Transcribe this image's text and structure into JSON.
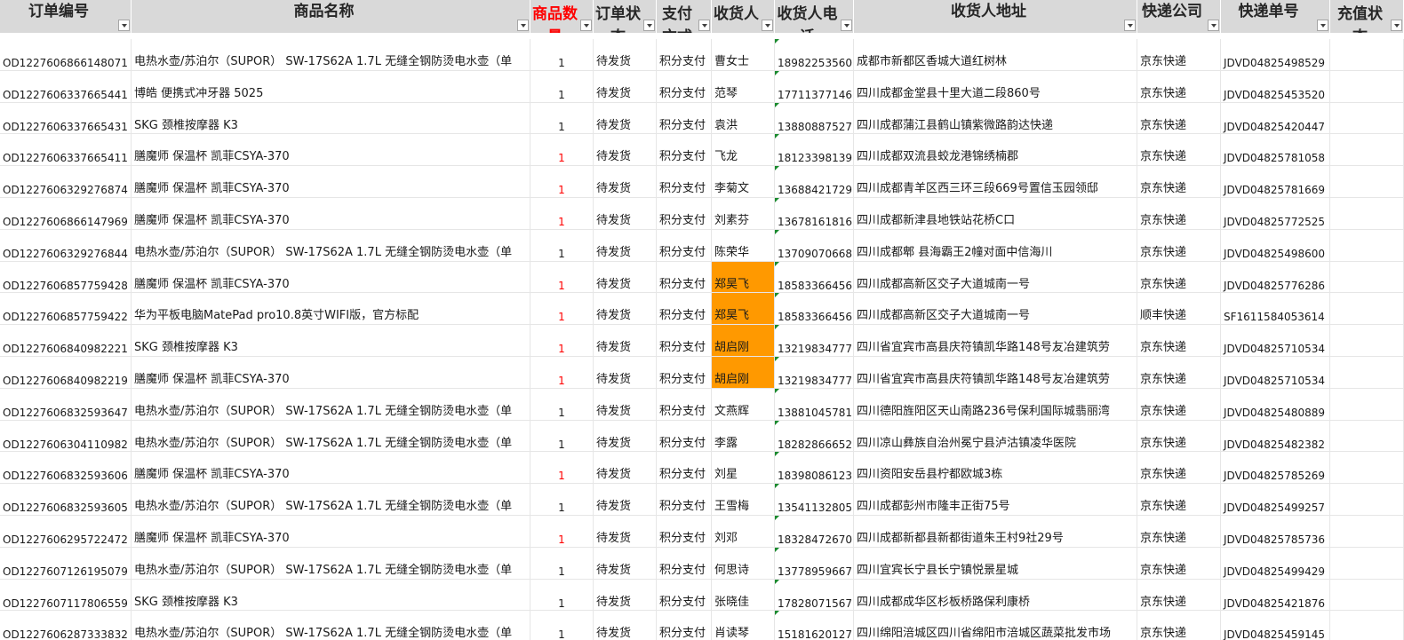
{
  "header": {
    "order_no": "订单编号",
    "product": "商品名称",
    "qty": "商品数量",
    "status": "订单状态",
    "pay": "支付方式",
    "receiver": "收货人",
    "phone": "收货人电话",
    "address": "收货人地址",
    "courier": "快递公司",
    "tracking": "快递单号",
    "recharge": "充值状态"
  },
  "accent": {
    "header_bg": "#d9d9d9",
    "highlight": "#ff9900",
    "red_text": "#ff0000",
    "grid": "#e6e6e6"
  },
  "rows": [
    {
      "order_no": "OD1227606866148071",
      "product": "电热水壶/苏泊尔（SUPOR） SW-17S62A 1.7L 无缝全钢防烫电水壶（单",
      "qty": "1",
      "status": "待发货",
      "pay": "积分支付",
      "receiver": "曹女士",
      "phone": "18982253560",
      "address": "成都市新都区香城大道红树林",
      "courier": "京东快递",
      "tracking": "JDVD04825498529",
      "qty_red": false,
      "hl": false
    },
    {
      "order_no": "OD1227606337665441",
      "product": "博皓 便携式冲牙器 5025",
      "qty": "1",
      "status": "待发货",
      "pay": "积分支付",
      "receiver": "范琴",
      "phone": "17711377146",
      "address": "四川成都金堂县十里大道二段860号",
      "courier": "京东快递",
      "tracking": "JDVD04825453520",
      "qty_red": false,
      "hl": false
    },
    {
      "order_no": "OD1227606337665431",
      "product": "SKG 颈椎按摩器 K3",
      "qty": "1",
      "status": "待发货",
      "pay": "积分支付",
      "receiver": "袁洪",
      "phone": "13880887527",
      "address": "四川成都蒲江县鹤山镇紫微路韵达快递",
      "courier": "京东快递",
      "tracking": "JDVD04825420447",
      "qty_red": false,
      "hl": false
    },
    {
      "order_no": "OD1227606337665411",
      "product": "膳魔师 保温杯 凯菲CSYA-370",
      "qty": "1",
      "status": "待发货",
      "pay": "积分支付",
      "receiver": "飞龙",
      "phone": "18123398139",
      "address": "四川成都双流县蛟龙港锦绣楠郡",
      "courier": "京东快递",
      "tracking": "JDVD04825781058",
      "qty_red": true,
      "hl": false
    },
    {
      "order_no": "OD1227606329276874",
      "product": "膳魔师 保温杯 凯菲CSYA-370",
      "qty": "1",
      "status": "待发货",
      "pay": "积分支付",
      "receiver": "李菊文",
      "phone": "13688421729",
      "address": "四川成都青羊区西三环三段669号置信玉园领邸",
      "courier": "京东快递",
      "tracking": "JDVD04825781669",
      "qty_red": true,
      "hl": false
    },
    {
      "order_no": "OD1227606866147969",
      "product": "膳魔师 保温杯 凯菲CSYA-370",
      "qty": "1",
      "status": "待发货",
      "pay": "积分支付",
      "receiver": "刘素芬",
      "phone": "13678161816",
      "address": "四川成都新津县地铁站花桥C口",
      "courier": "京东快递",
      "tracking": "JDVD04825772525",
      "qty_red": true,
      "hl": false
    },
    {
      "order_no": "OD1227606329276844",
      "product": "电热水壶/苏泊尔（SUPOR） SW-17S62A 1.7L 无缝全钢防烫电水壶（单",
      "qty": "1",
      "status": "待发货",
      "pay": "积分支付",
      "receiver": "陈荣华",
      "phone": "13709070668",
      "address": "四川成都郫 县海霸王2幢对面中信海川",
      "courier": "京东快递",
      "tracking": "JDVD04825498600",
      "qty_red": false,
      "hl": false
    },
    {
      "order_no": "OD1227606857759428",
      "product": "膳魔师 保温杯 凯菲CSYA-370",
      "qty": "1",
      "status": "待发货",
      "pay": "积分支付",
      "receiver": "郑昊飞",
      "phone": "18583366456",
      "address": "四川成都高新区交子大道城南一号",
      "courier": "京东快递",
      "tracking": "JDVD04825776286",
      "qty_red": true,
      "hl": true
    },
    {
      "order_no": "OD1227606857759422",
      "product": "华为平板电脑MatePad pro10.8英寸WIFI版，官方标配",
      "qty": "1",
      "status": "待发货",
      "pay": "积分支付",
      "receiver": "郑昊飞",
      "phone": "18583366456",
      "address": "四川成都高新区交子大道城南一号",
      "courier": "顺丰快递",
      "tracking": "SF1611584053614",
      "qty_red": true,
      "hl": true
    },
    {
      "order_no": "OD1227606840982221",
      "product": "SKG 颈椎按摩器 K3",
      "qty": "1",
      "status": "待发货",
      "pay": "积分支付",
      "receiver": "胡启刚",
      "phone": "13219834777",
      "address": "四川省宜宾市高县庆符镇凯华路148号友冶建筑劳",
      "courier": "京东快递",
      "tracking": "JDVD04825710534",
      "qty_red": true,
      "hl": true
    },
    {
      "order_no": "OD1227606840982219",
      "product": "膳魔师 保温杯 凯菲CSYA-370",
      "qty": "1",
      "status": "待发货",
      "pay": "积分支付",
      "receiver": "胡启刚",
      "phone": "13219834777",
      "address": "四川省宜宾市高县庆符镇凯华路148号友冶建筑劳",
      "courier": "京东快递",
      "tracking": "JDVD04825710534",
      "qty_red": true,
      "hl": true
    },
    {
      "order_no": "OD1227606832593647",
      "product": "电热水壶/苏泊尔（SUPOR） SW-17S62A 1.7L 无缝全钢防烫电水壶（单",
      "qty": "1",
      "status": "待发货",
      "pay": "积分支付",
      "receiver": "文燕辉",
      "phone": "13881045781",
      "address": "四川德阳旌阳区天山南路236号保利国际城翡丽湾",
      "courier": "京东快递",
      "tracking": "JDVD04825480889",
      "qty_red": false,
      "hl": false
    },
    {
      "order_no": "OD1227606304110982",
      "product": "电热水壶/苏泊尔（SUPOR） SW-17S62A 1.7L 无缝全钢防烫电水壶（单",
      "qty": "1",
      "status": "待发货",
      "pay": "积分支付",
      "receiver": "李露",
      "phone": "18282866652",
      "address": "四川凉山彝族自治州冕宁县泸沽镇凌华医院",
      "courier": "京东快递",
      "tracking": "JDVD04825482382",
      "qty_red": false,
      "hl": false
    },
    {
      "order_no": "OD1227606832593606",
      "product": "膳魔师 保温杯 凯菲CSYA-370",
      "qty": "1",
      "status": "待发货",
      "pay": "积分支付",
      "receiver": "刘星",
      "phone": "18398086123",
      "address": "四川资阳安岳县柠都欧城3栋",
      "courier": "京东快递",
      "tracking": "JDVD04825785269",
      "qty_red": true,
      "hl": false
    },
    {
      "order_no": "OD1227606832593605",
      "product": "电热水壶/苏泊尔（SUPOR） SW-17S62A 1.7L 无缝全钢防烫电水壶（单",
      "qty": "1",
      "status": "待发货",
      "pay": "积分支付",
      "receiver": "王雪梅",
      "phone": "13541132805",
      "address": "四川成都彭州市隆丰正街75号",
      "courier": "京东快递",
      "tracking": "JDVD04825499257",
      "qty_red": false,
      "hl": false
    },
    {
      "order_no": "OD1227606295722472",
      "product": "膳魔师 保温杯 凯菲CSYA-370",
      "qty": "1",
      "status": "待发货",
      "pay": "积分支付",
      "receiver": "刘邓",
      "phone": "18328472670",
      "address": "四川成都新都县新都街道朱王村9社29号",
      "courier": "京东快递",
      "tracking": "JDVD04825785736",
      "qty_red": true,
      "hl": false
    },
    {
      "order_no": "OD1227607126195079",
      "product": "电热水壶/苏泊尔（SUPOR） SW-17S62A 1.7L 无缝全钢防烫电水壶（单",
      "qty": "1",
      "status": "待发货",
      "pay": "积分支付",
      "receiver": "何思诗",
      "phone": "13778959667",
      "address": "四川宜宾长宁县长宁镇悦景星城",
      "courier": "京东快递",
      "tracking": "JDVD04825499429",
      "qty_red": false,
      "hl": false
    },
    {
      "order_no": "OD1227607117806559",
      "product": "SKG 颈椎按摩器 K3",
      "qty": "1",
      "status": "待发货",
      "pay": "积分支付",
      "receiver": "张晓佳",
      "phone": "17828071567",
      "address": "四川成都成华区杉板桥路保利康桥",
      "courier": "京东快递",
      "tracking": "JDVD04825421876",
      "qty_red": false,
      "hl": false
    },
    {
      "order_no": "OD1227606287333832",
      "product": "电热水壶/苏泊尔（SUPOR） SW-17S62A 1.7L 无缝全钢防烫电水壶（单",
      "qty": "1",
      "status": "待发货",
      "pay": "积分支付",
      "receiver": "肖读琴",
      "phone": "15181620127",
      "address": "四川绵阳涪城区四川省绵阳市涪城区蔬菜批发市场",
      "courier": "京东快递",
      "tracking": "JDVD04825459145",
      "qty_red": false,
      "hl": false
    }
  ]
}
